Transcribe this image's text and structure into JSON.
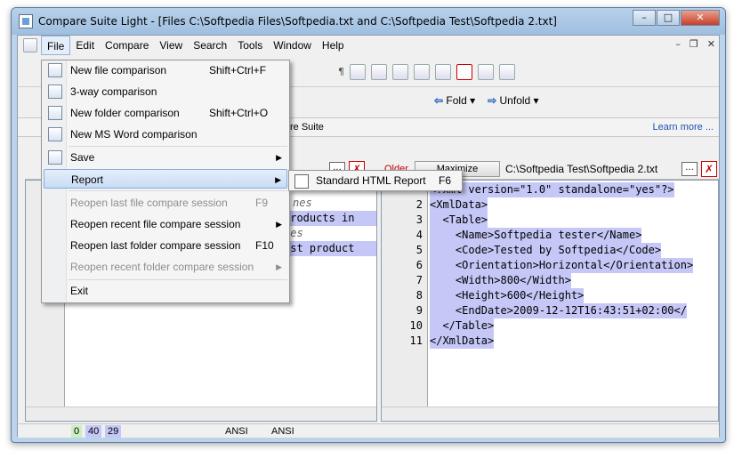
{
  "window": {
    "title": "Compare Suite Light - [Files C:\\Softpedia Files\\Softpedia.txt and C:\\Softpedia Test\\Softpedia 2.txt]"
  },
  "menubar": {
    "items": [
      "File",
      "Edit",
      "Compare",
      "View",
      "Search",
      "Tools",
      "Window",
      "Help"
    ]
  },
  "toolbar": {
    "fold": "Fold",
    "unfold": "Unfold"
  },
  "tabstrip": {
    "suite_text": "re Suite",
    "learn_more": "Learn more ..."
  },
  "right_header": {
    "older": "Older",
    "maximize": "Maximize",
    "path": "C:\\Softpedia Test\\Softpedia 2.txt"
  },
  "file_menu": {
    "items": [
      {
        "label": "New file comparison",
        "shortcut": "Shift+Ctrl+F",
        "icon": "new-file-icon"
      },
      {
        "label": "3-way comparison",
        "shortcut": "",
        "icon": "three-way-icon"
      },
      {
        "label": "New folder comparison",
        "shortcut": "Shift+Ctrl+O",
        "icon": "folder-icon"
      },
      {
        "label": "New MS Word comparison",
        "shortcut": "",
        "icon": "word-icon"
      },
      {
        "label": "Save",
        "shortcut": "",
        "icon": "save-icon",
        "submenu": true
      },
      {
        "label": "Report",
        "shortcut": "",
        "submenu": true,
        "highlighted": true
      },
      {
        "label": "Reopen last file compare session",
        "shortcut": "F9",
        "disabled": true
      },
      {
        "label": "Reopen recent file compare session",
        "shortcut": "",
        "submenu": true
      },
      {
        "label": "Reopen last folder compare session",
        "shortcut": "F10"
      },
      {
        "label": "Reopen recent folder compare session",
        "shortcut": "",
        "submenu": true,
        "disabled": true
      },
      {
        "label": "Exit",
        "shortcut": ""
      }
    ]
  },
  "report_submenu": {
    "label": "Standard HTML Report",
    "shortcut": "F6"
  },
  "left_pane": {
    "lines": [
      {
        "text": "nes",
        "style": "italic"
      },
      {
        "text": "products in",
        "style": "selected"
      },
      {
        "text": "nes",
        "style": "italic"
      },
      {
        "text": "est product",
        "style": "selected"
      }
    ]
  },
  "right_pane": {
    "lines": [
      {
        "num": "",
        "text": "<?xml version=\"1.0\" standalone=\"yes\"?>"
      },
      {
        "num": "2",
        "text": "<XmlData>"
      },
      {
        "num": "3",
        "text": "  <Table>"
      },
      {
        "num": "4",
        "text": "    <Name>Softpedia tester</Name>"
      },
      {
        "num": "5",
        "text": "    <Code>Tested by Softpedia</Code>"
      },
      {
        "num": "6",
        "text": "    <Orientation>Horizontal</Orientation>"
      },
      {
        "num": "7",
        "text": "    <Width>800</Width>"
      },
      {
        "num": "8",
        "text": "    <Height>600</Height>"
      },
      {
        "num": "9",
        "text": "    <EndDate>2009-12-12T16:43:51+02:00</"
      },
      {
        "num": "10",
        "text": "  </Table>"
      },
      {
        "num": "11",
        "text": "</XmlData>"
      }
    ]
  },
  "statusbar": {
    "counts": [
      "0",
      "40",
      "29"
    ],
    "encoding_left": "ANSI",
    "encoding_right": "ANSI"
  },
  "colors": {
    "selection": "#c5c7f7",
    "accent": "#1c52b0",
    "red": "#c00000"
  }
}
